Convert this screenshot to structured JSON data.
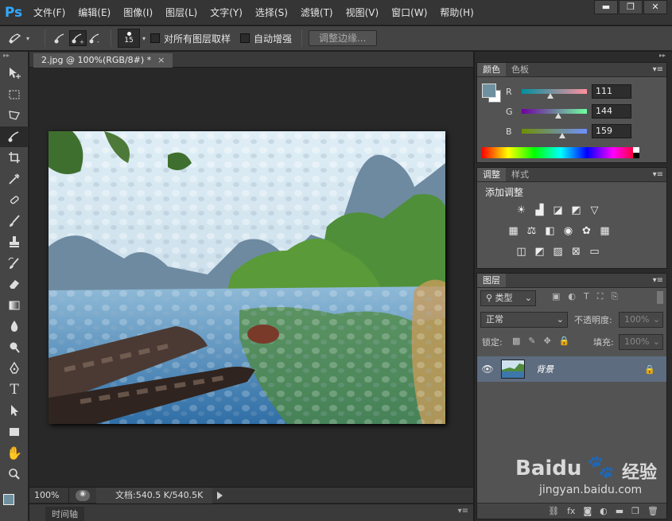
{
  "app": {
    "logo": "Ps"
  },
  "menu": [
    "文件(F)",
    "编辑(E)",
    "图像(I)",
    "图层(L)",
    "文字(Y)",
    "选择(S)",
    "滤镜(T)",
    "视图(V)",
    "窗口(W)",
    "帮助(H)"
  ],
  "window_controls": {
    "minimize": "▬",
    "restore": "❐",
    "close": "✕"
  },
  "options": {
    "brush_size": "15",
    "sample_all_layers": "对所有图层取样",
    "auto_enhance": "自动增强",
    "refine_edge": "调整边缘..."
  },
  "document": {
    "tab_title": "2.jpg @ 100%(RGB/8#) *",
    "tab_close": "×",
    "zoom": "100%",
    "doc_info": "文档:540.5 K/540.5K"
  },
  "timeline": {
    "label": "时间轴"
  },
  "color_panel": {
    "tabs": [
      "颜色",
      "色板"
    ],
    "channels": [
      {
        "label": "R",
        "value": "111",
        "level": 0.435
      },
      {
        "label": "G",
        "value": "144",
        "level": 0.565
      },
      {
        "label": "B",
        "value": "159",
        "level": 0.624
      }
    ],
    "foreground": "#6f909f",
    "background": "#ffffff"
  },
  "adjustments_panel": {
    "tabs": [
      "调整",
      "样式"
    ],
    "title": "添加调整"
  },
  "layers_panel": {
    "tab": "图层",
    "filter_kind": "类型",
    "blend_mode": "正常",
    "opacity_label": "不透明度:",
    "opacity_value": "100%",
    "lock_label": "锁定:",
    "fill_label": "填充:",
    "fill_value": "100%",
    "layers": [
      {
        "name": "背景",
        "visible": true,
        "locked": true
      }
    ],
    "footer_icons": [
      "link-icon",
      "fx-icon",
      "mask-icon",
      "adjustment-icon",
      "group-icon",
      "new-layer-icon",
      "delete-icon"
    ]
  },
  "watermark": {
    "brand": "Baidu",
    "paw": "🐾",
    "cn": "经验",
    "url": "jingyan.baidu.com"
  },
  "colors": {
    "accent": "#31a8ff",
    "selected_layer": "#5e6c80"
  }
}
